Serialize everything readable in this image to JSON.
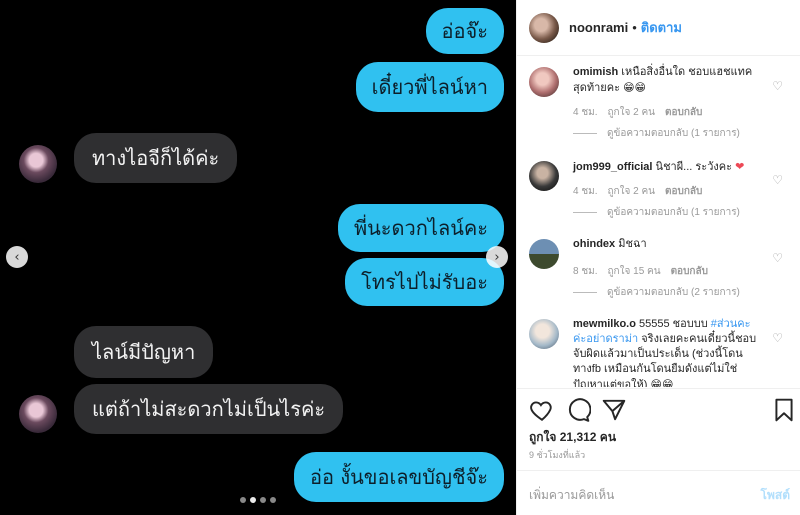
{
  "chat": {
    "messages": [
      {
        "side": "out",
        "text": "อ่อจ๊ะ"
      },
      {
        "side": "out",
        "text": "เดี๋ยวพี่ไลน์หา"
      },
      {
        "side": "in",
        "text": "ทางไอจีก็ได้ค่ะ"
      },
      {
        "side": "out",
        "text": "พี่นะดวกไลน์คะ"
      },
      {
        "side": "out",
        "text": "โทรไปไม่รับอะ"
      },
      {
        "side": "in",
        "text": "ไลน์มีปัญหา"
      },
      {
        "side": "in",
        "text": "แต่ถ้าไม่สะดวกไม่เป็นไรค่ะ"
      },
      {
        "side": "out",
        "text": "อ่อ งั้นขอเลขบัญชีจ๊ะ"
      }
    ],
    "prev_arrow": "‹",
    "next_arrow": "›",
    "carousel": {
      "count": 4,
      "active_index": 1
    }
  },
  "header": {
    "username": "noonrami",
    "separator": "•",
    "follow_label": "ติดตาม"
  },
  "comments": [
    {
      "username": "omimish",
      "text": "เหนือสิ่งอื่นใด ชอบแฮชแทคสุดท้ายคะ",
      "emoji": "😁😁",
      "age": "4 ชม.",
      "likes": "ถูกใจ 2 คน",
      "reply": "ตอบกลับ",
      "view_replies": "ดูข้อความตอบกลับ (1 รายการ)",
      "heart_color": "#999999"
    },
    {
      "username": "jom999_official",
      "text": "นิชาผี... ระวังคะ",
      "emoji": "❤",
      "age": "4 ชม.",
      "likes": "ถูกใจ 2 คน",
      "reply": "ตอบกลับ",
      "view_replies": "ดูข้อความตอบกลับ (1 รายการ)",
      "heart_color": "#999999",
      "emoji_color": "#ed4956"
    },
    {
      "username": "ohindex",
      "text": "มิชฉา",
      "age": "8 ชม.",
      "likes": "ถูกใจ 15 คน",
      "reply": "ตอบกลับ",
      "view_replies": "ดูข้อความตอบกลับ (2 รายการ)",
      "heart_color": "#999999"
    },
    {
      "username": "mewmilko.o",
      "text_before": "55555 ชอบบบ",
      "hashtag": "#ส่วนคะค่ะอย่าดราม่า",
      "text_after": "จริงเลยคะคนเดี๋ยวนี้ชอบจับผิดแล้วมาเป็นประเด็น (ช่วงนี้โดนทางfb เหมือนกันโดนยืมดังแต่ไม่ใช่ปัญหาแต่ขอให้)",
      "emoji": "😁😁",
      "heart_color": "#999999"
    }
  ],
  "icons": {
    "heart": "heart-icon",
    "comment": "comment-icon",
    "share": "share-icon",
    "save": "bookmark-icon"
  },
  "likes_label": "ถูกใจ 21,312 คน",
  "post_time": "9 ชั่วโมงที่แล้ว",
  "add_comment_placeholder": "เพิ่มความคิดเห็น",
  "post_button": "โพสต์",
  "colors": {
    "outgoing_bubble": "#30c1f0",
    "incoming_bubble": "#2f2f31",
    "accent": "#3897f0",
    "like_red": "#ed4956"
  }
}
